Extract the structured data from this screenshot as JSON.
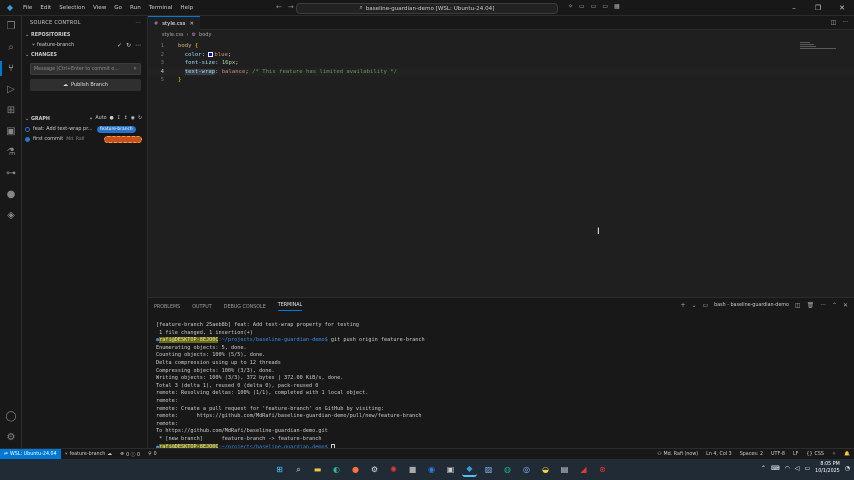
{
  "titlebar": {
    "menu": [
      "File",
      "Edit",
      "Selection",
      "View",
      "Go",
      "Run",
      "Terminal",
      "Help"
    ],
    "command_center": "baseline-guardian-demo [WSL: Ubuntu-24.04]"
  },
  "sidebar": {
    "title": "SOURCE CONTROL",
    "repositories_label": "REPOSITORIES",
    "repo_branch": "feature-branch",
    "changes_label": "CHANGES",
    "commit_placeholder": "Message (Ctrl+Enter to commit o...",
    "publish_label": "Publish Branch",
    "graph_label": "GRAPH",
    "graph_auto": "Auto",
    "commits": [
      {
        "message": "feat: Add text-wrap pr...",
        "badge": "feature-branch",
        "color": "#2a73c8"
      },
      {
        "message": "first commit",
        "author": "Md. Rafi",
        "color": "#2a73c8"
      }
    ]
  },
  "editor": {
    "tab_label": "style.css",
    "breadcrumb": [
      "style.css",
      "body"
    ],
    "lines": [
      {
        "n": "1",
        "selector": "body",
        "brace": "{"
      },
      {
        "n": "2",
        "prop": "color",
        "value": "blue"
      },
      {
        "n": "3",
        "prop": "font-size",
        "value": "16px"
      },
      {
        "n": "4",
        "prop": "text-wrap",
        "value": "balance",
        "comment": "/* This feature has limited availability */"
      },
      {
        "n": "5",
        "brace": "}"
      }
    ]
  },
  "panel": {
    "tabs": [
      "PROBLEMS",
      "OUTPUT",
      "DEBUG CONSOLE",
      "TERMINAL"
    ],
    "terminal_name": "bash - baseline-guardian-demo",
    "terminal_lines": [
      "[feature-branch 25aeb8b] feat: Add text-wrap property for testing",
      " 1 file changed, 1 insertion(+)",
      "",
      "Enumerating objects: 5, done.",
      "Counting objects: 100% (5/5), done.",
      "Delta compression using up to 12 threads",
      "Compressing objects: 100% (3/3), done.",
      "Writing objects: 100% (3/3), 372 bytes | 372.00 KiB/s, done.",
      "Total 3 (delta 1), reused 0 (delta 0), pack-reused 0",
      "remote: Resolving deltas: 100% (1/1), completed with 1 local object.",
      "remote:",
      "remote: Create a pull request for 'feature-branch' on GitHub by visiting:",
      "remote:      https://github.com/MdRafi/baseline-guardian-demo/pull/new/feature-branch",
      "remote:",
      "To https://github.com/MdRafi/baseline-guardian-demo.git",
      " * [new branch]      feature-branch -> feature-branch"
    ],
    "prompt_user": "rafi@DESKTOP-8EJO0C",
    "prompt_path": ":~/projects/baseline-guardian-demo$",
    "push_command": " git push origin feature-branch"
  },
  "statusbar": {
    "remote": "WSL: Ubuntu-24.04",
    "branch": "feature-branch",
    "problems": "0 ⓘ 0",
    "ports": "0",
    "author": "Md. Rafi (now)",
    "position": "Ln 4, Col 3",
    "spaces": "Spaces: 2",
    "encoding": "UTF-8",
    "eol": "LF",
    "language": "CSS"
  },
  "taskbar": {
    "time": "8:05 PM",
    "date": "10/1/2025"
  },
  "colors": {
    "accent": "#0078d4",
    "branch_badge": "#2a73c8",
    "selector": "#d7ba7d",
    "property": "#9cdcfe",
    "value": "#ce9178",
    "comment": "#6a9955"
  }
}
